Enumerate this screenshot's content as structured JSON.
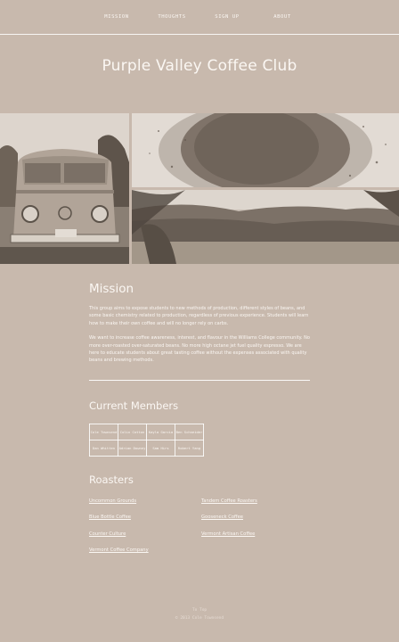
{
  "nav": [
    "Mission",
    "Thoughts",
    "Sign Up",
    "About"
  ],
  "site_title": "Purple Valley Coffee Club",
  "mission": {
    "heading": "Mission",
    "p1": "This group aims to expose students to new methods of production, different styles of beans, and some basic chemistry related to production, regardless of previous experience. Students will learn how to make their own coffee and will no longer rely on carbs.",
    "p2": "We want to increase coffee awareness, interest, and flavour in the Williams College community. No more over-roasted over-saturated beans. No more high octane jet fuel quality espresso. We are here to educate students about great tasting coffee without the expenses associated with quality beans and brewing methods."
  },
  "members": {
    "heading": "Current Members",
    "rows": [
      [
        "Cole Townsend",
        "Colin Cotton",
        "Kayla Garcia",
        "Ben Schneider"
      ],
      [
        "Dan Whitten",
        "Adrian Downey",
        "Sam Hirs",
        "Robert Yang"
      ]
    ]
  },
  "roasters": {
    "heading": "Roasters",
    "items": [
      "Uncommon Grounds",
      "Tandem Coffee Roasters",
      "Blue Bottle Coffee",
      "Gooseneck Coffee",
      "Counter Culture",
      "Vermont Artisan Coffee",
      "Vermont Coffee Company"
    ]
  },
  "footer": {
    "line1": "To Top",
    "line2": "© 2013 Cole Townsend"
  },
  "colors": {
    "background": "#c8b9ad",
    "text": "#fbf7f3"
  }
}
